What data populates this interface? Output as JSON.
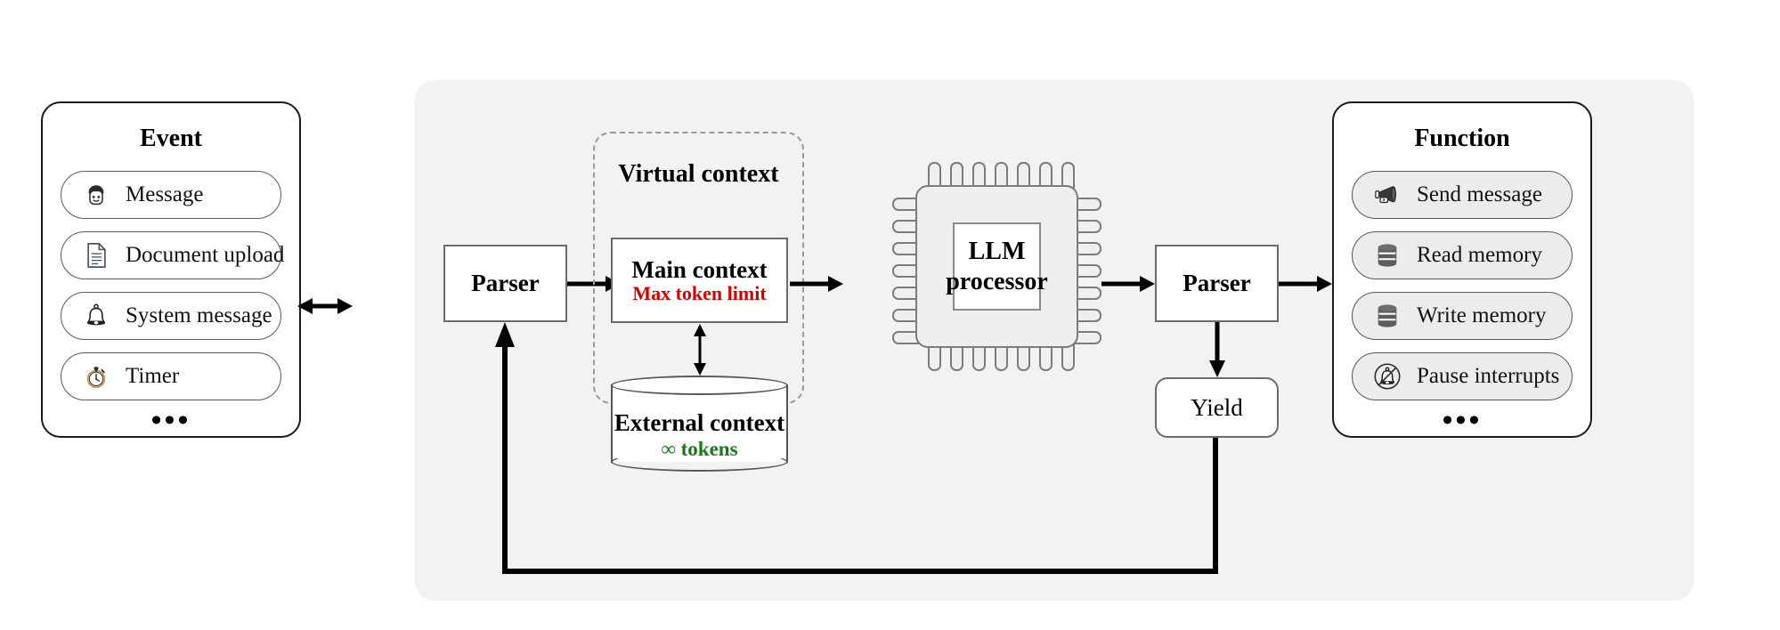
{
  "diagram": {
    "title": "MemGPT virtual context management architecture",
    "background_panel_color": "#f2f2f2"
  },
  "event_panel": {
    "title": "Event",
    "items": [
      {
        "label": "Message",
        "icon": "user-avatar-icon"
      },
      {
        "label": "Document upload",
        "icon": "document-icon"
      },
      {
        "label": "System message",
        "icon": "bell-icon"
      },
      {
        "label": "Timer",
        "icon": "stopwatch-icon"
      }
    ],
    "more": "•••"
  },
  "function_panel": {
    "title": "Function",
    "items": [
      {
        "label": "Send message",
        "icon": "megaphone-icon"
      },
      {
        "label": "Read memory",
        "icon": "database-icon"
      },
      {
        "label": "Write memory",
        "icon": "database-icon"
      },
      {
        "label": "Pause interrupts",
        "icon": "bell-off-icon"
      }
    ],
    "more": "•••"
  },
  "parsers": {
    "input_label": "Parser",
    "output_label": "Parser"
  },
  "yield": {
    "label": "Yield"
  },
  "virtual_context": {
    "title": "Virtual context",
    "main_context": {
      "title": "Main context",
      "subtitle": "Max token limit",
      "subtitle_color": "#d40000"
    },
    "external_context": {
      "title": "External context",
      "subtitle": "∞ tokens",
      "subtitle_color": "#1a7a1a"
    }
  },
  "processor": {
    "line1": "LLM",
    "line2": "processor",
    "pin_count_top": 7,
    "pin_count_bottom": 7,
    "pin_count_left": 7,
    "pin_count_right": 7
  }
}
